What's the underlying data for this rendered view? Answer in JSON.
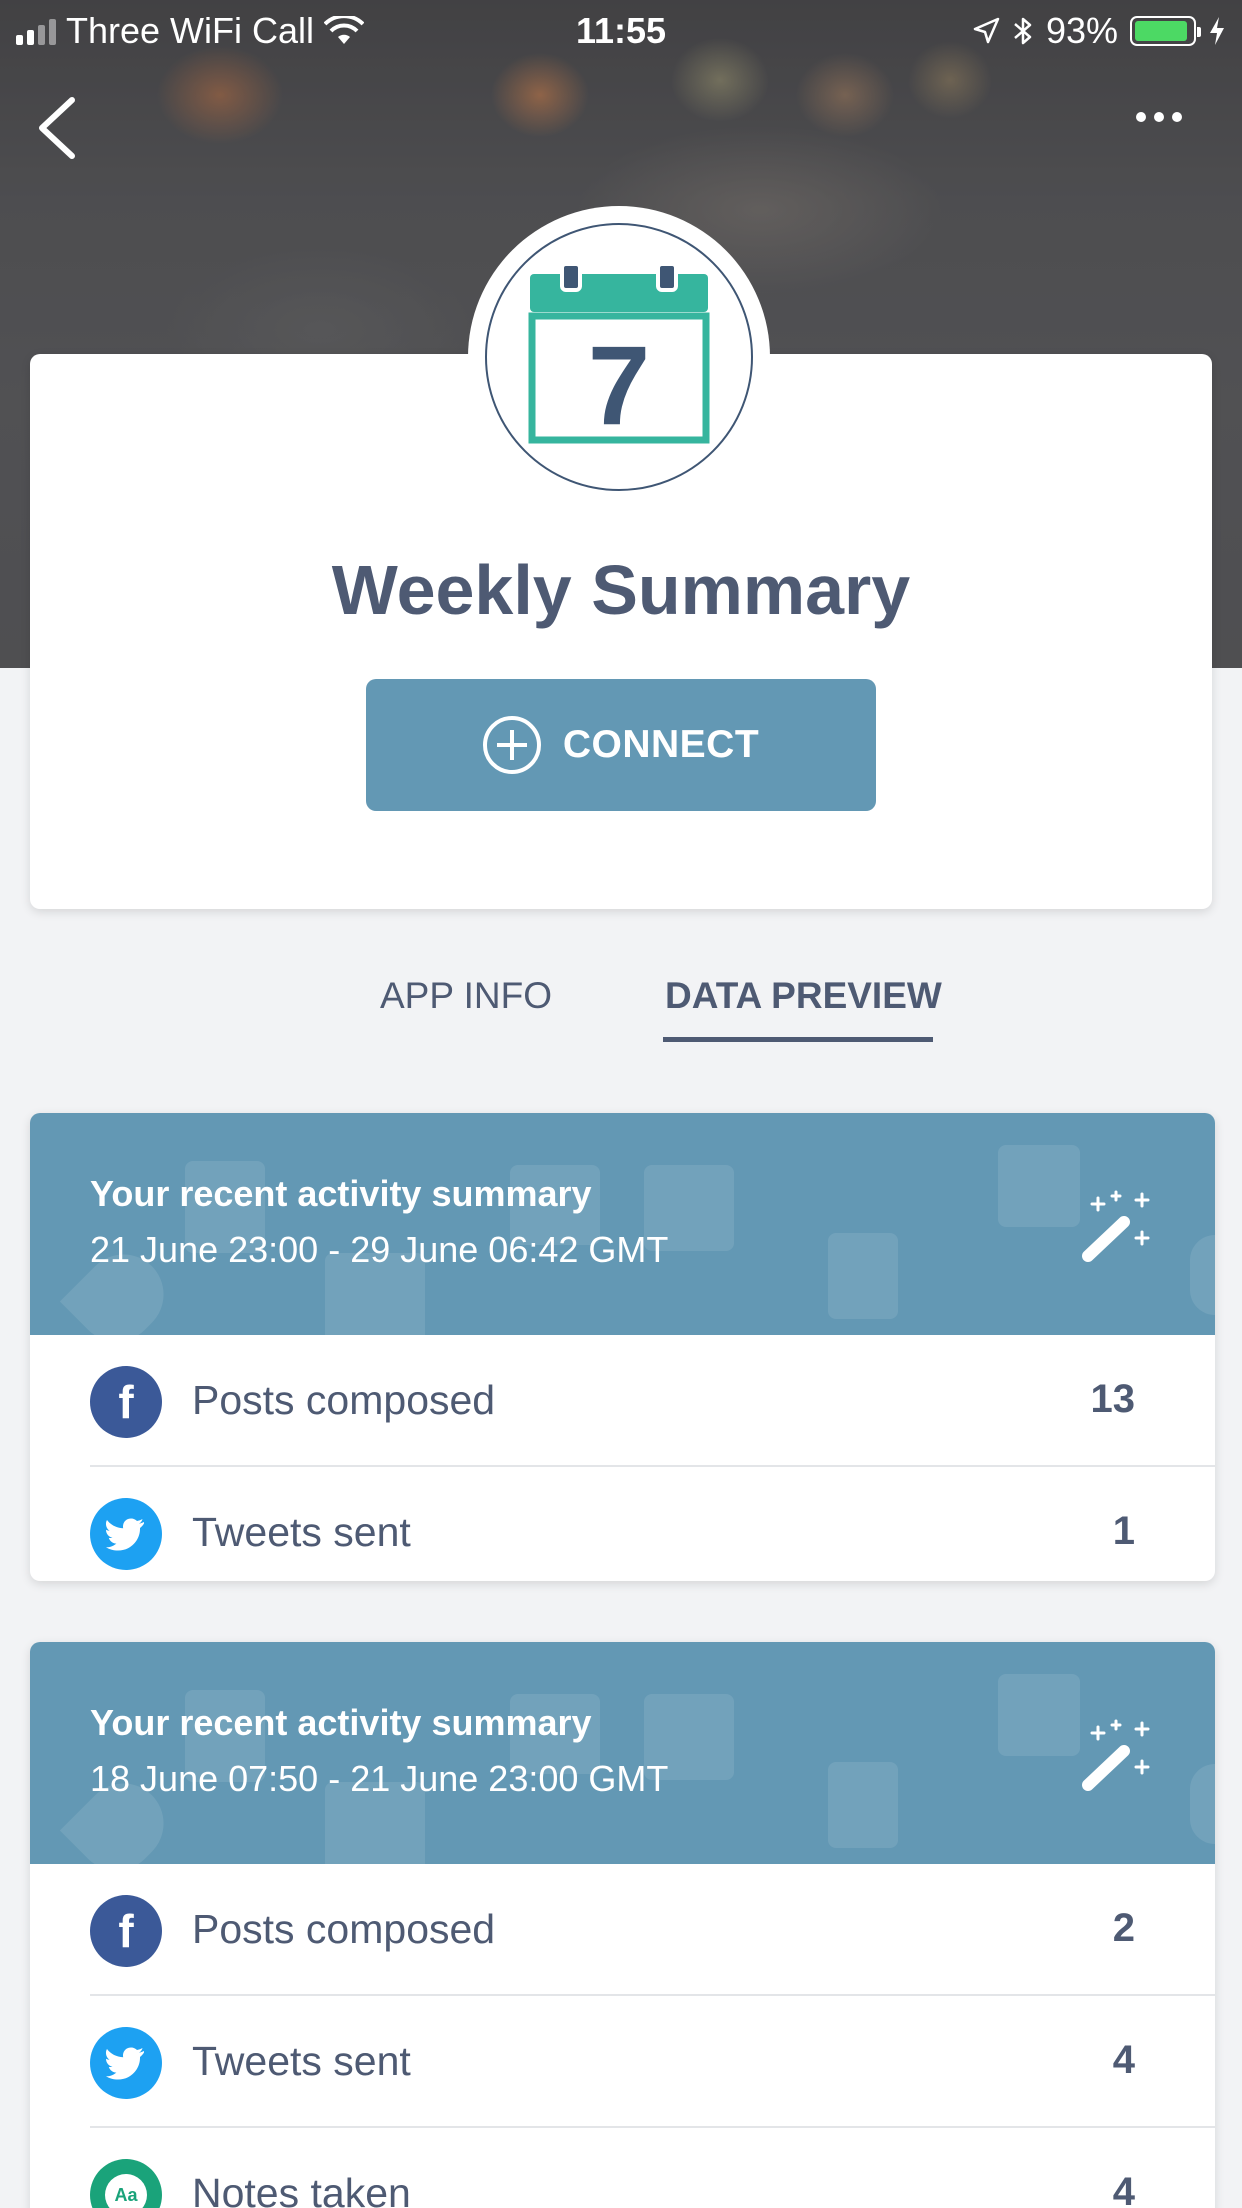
{
  "status_bar": {
    "carrier": "Three WiFi Call",
    "time": "11:55",
    "battery": "93%",
    "battery_level": 0.93,
    "battery_color": "#4cd964"
  },
  "nav": {
    "back_icon": "chevron-left-icon",
    "more_icon": "ellipsis-icon"
  },
  "app": {
    "icon_number": "7",
    "title": "Weekly Summary",
    "connect_label": "CONNECT",
    "accent_color": "#6398b4",
    "icon_green": "#36b59e"
  },
  "tabs": [
    {
      "label": "APP INFO",
      "active": false
    },
    {
      "label": "DATA PREVIEW",
      "active": true
    }
  ],
  "summaries": [
    {
      "title": "Your recent activity summary",
      "range": "21 June 23:00 - 29 June 06:42 GMT",
      "rows": [
        {
          "icon": "facebook-icon",
          "label": "Posts composed",
          "value": "13"
        },
        {
          "icon": "twitter-icon",
          "label": "Tweets sent",
          "value": "1"
        }
      ]
    },
    {
      "title": "Your recent activity summary",
      "range": "18 June 07:50 - 21 June 23:00 GMT",
      "rows": [
        {
          "icon": "facebook-icon",
          "label": "Posts composed",
          "value": "2"
        },
        {
          "icon": "twitter-icon",
          "label": "Tweets sent",
          "value": "4"
        },
        {
          "icon": "notes-icon",
          "label": "Notes taken",
          "value": "4",
          "icon_text": "Aa"
        }
      ]
    }
  ]
}
